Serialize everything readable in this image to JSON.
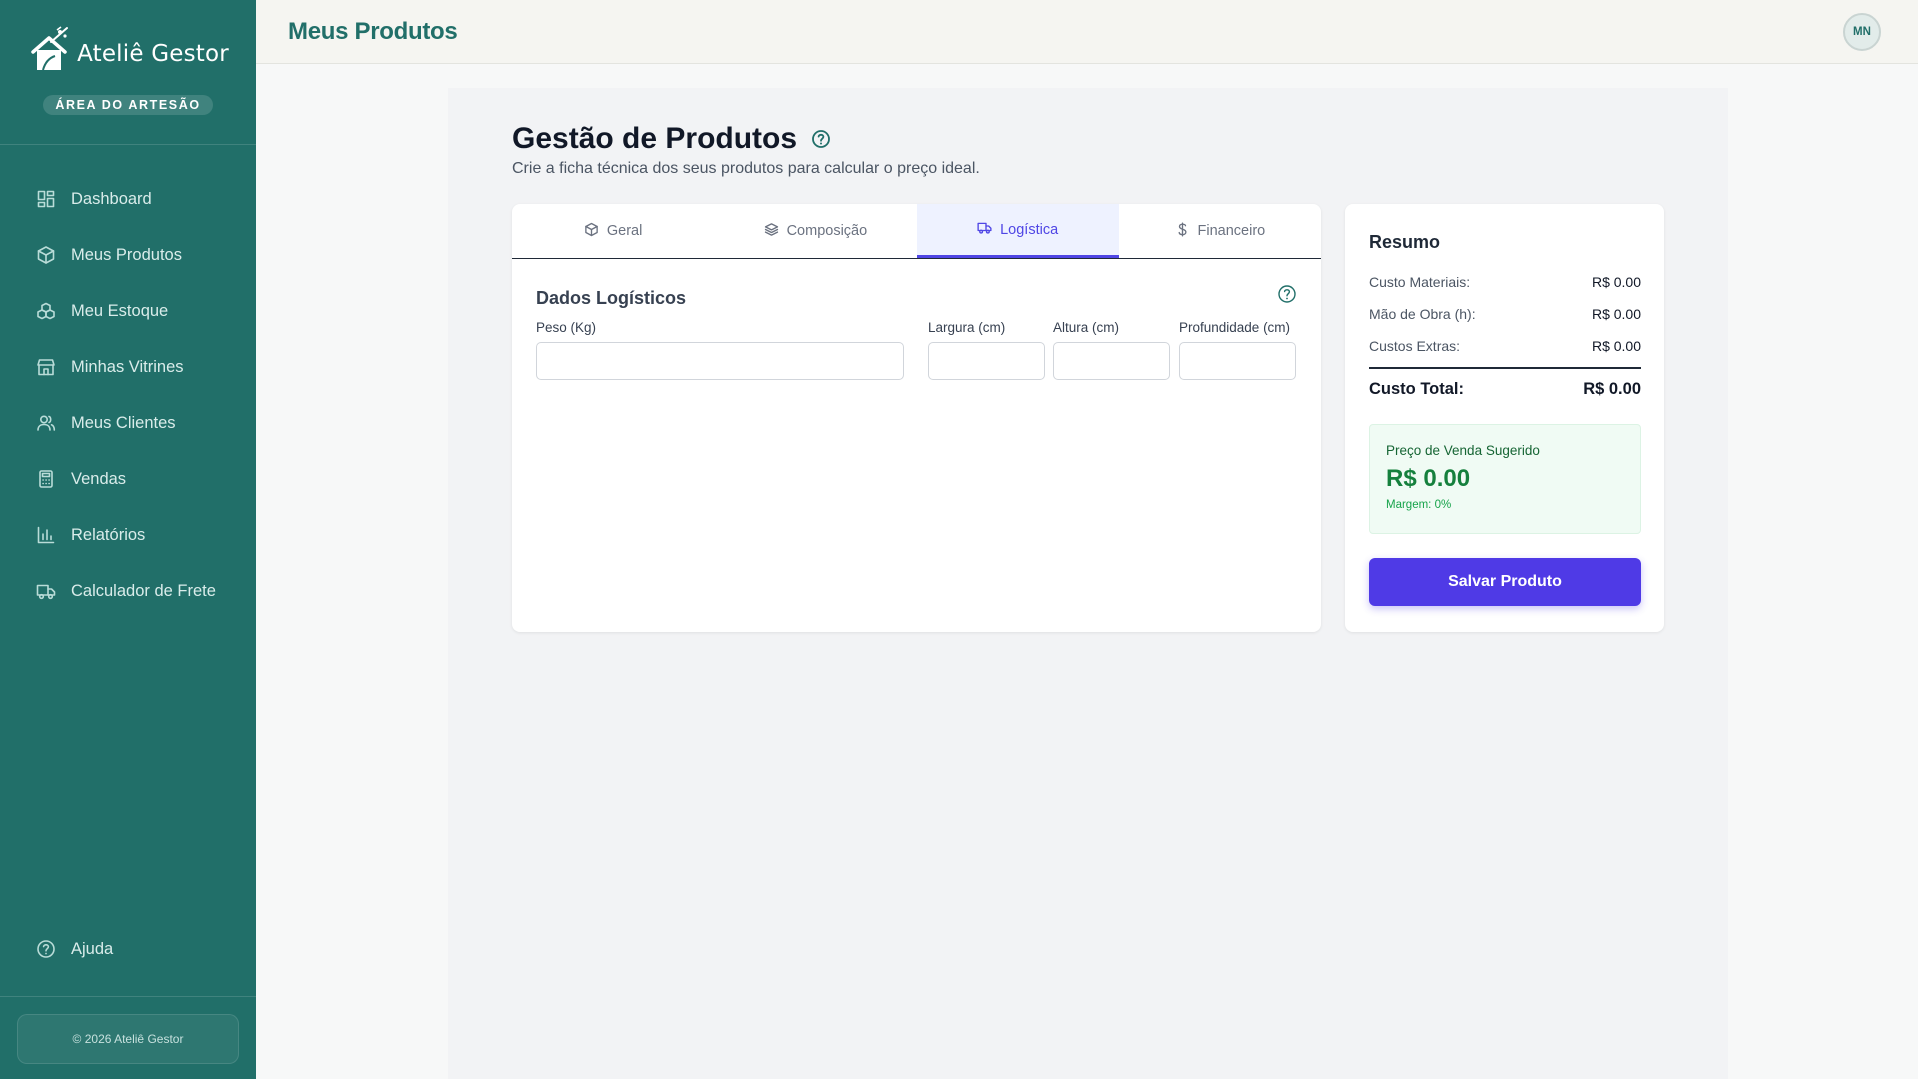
{
  "brand": {
    "name": "Ateliê Gestor",
    "badge": "ÁREA DO ARTESÃO"
  },
  "sidebar": {
    "items": [
      {
        "label": "Dashboard",
        "icon": "dashboard-icon"
      },
      {
        "label": "Meus Produtos",
        "icon": "box-icon"
      },
      {
        "label": "Meu Estoque",
        "icon": "boxes-icon"
      },
      {
        "label": "Minhas Vitrines",
        "icon": "store-icon"
      },
      {
        "label": "Meus Clientes",
        "icon": "users-icon"
      },
      {
        "label": "Vendas",
        "icon": "calculator-icon"
      },
      {
        "label": "Relatórios",
        "icon": "bar-chart-icon"
      },
      {
        "label": "Calculador de Frete",
        "icon": "truck-icon"
      }
    ],
    "help": {
      "label": "Ajuda",
      "icon": "help-circle-icon"
    },
    "footer": "© 2026 Ateliê Gestor"
  },
  "header": {
    "title": "Meus Produtos",
    "avatar_initials": "MN"
  },
  "page": {
    "title": "Gestão de Produtos",
    "subtitle": "Crie a ficha técnica dos seus produtos para calcular o preço ideal."
  },
  "tabs": [
    {
      "label": "Geral",
      "icon": "box-icon",
      "active": false
    },
    {
      "label": "Composição",
      "icon": "layers-icon",
      "active": false
    },
    {
      "label": "Logística",
      "icon": "truck-icon",
      "active": true
    },
    {
      "label": "Financeiro",
      "icon": "dollar-icon",
      "active": false
    }
  ],
  "logistics": {
    "title": "Dados Logísticos",
    "fields": {
      "weight": {
        "label": "Peso (Kg)",
        "value": ""
      },
      "width": {
        "label": "Largura (cm)",
        "value": ""
      },
      "height": {
        "label": "Altura (cm)",
        "value": ""
      },
      "depth": {
        "label": "Profundidade (cm)",
        "value": ""
      }
    }
  },
  "summary": {
    "title": "Resumo",
    "rows": [
      {
        "label": "Custo Materiais:",
        "value": "R$ 0.00"
      },
      {
        "label": "Mão de Obra (h):",
        "value": "R$ 0.00"
      },
      {
        "label": "Custos Extras:",
        "value": "R$ 0.00"
      }
    ],
    "total_label": "Custo Total:",
    "total_value": "R$ 0.00",
    "suggested_label": "Preço de Venda Sugerido",
    "suggested_value": "R$ 0.00",
    "margin": "Margem: 0%",
    "save_label": "Salvar Produto"
  },
  "colors": {
    "sidebar": "#216f69",
    "accent": "#4f46e5",
    "success": "#15803d"
  }
}
